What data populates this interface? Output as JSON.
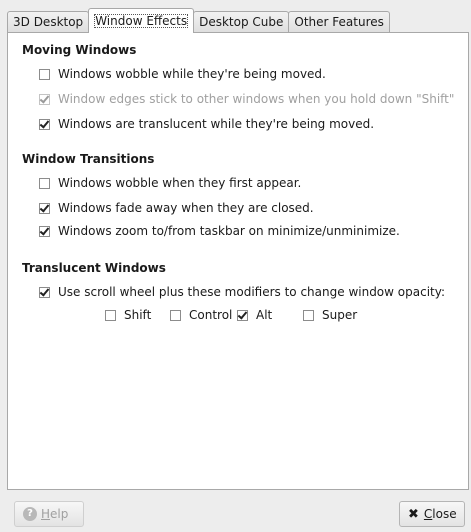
{
  "tabs": [
    "3D Desktop",
    "Window Effects",
    "Desktop Cube",
    "Other Features"
  ],
  "active_tab": "Window Effects",
  "sections": {
    "moving": {
      "title": "Moving Windows",
      "items": [
        {
          "label": "Windows wobble while they're being moved.",
          "checked": false,
          "enabled": true
        },
        {
          "label": "Window edges stick to other windows when you hold down \"Shift\"",
          "checked": true,
          "enabled": false
        },
        {
          "label": "Windows are translucent while they're being moved.",
          "checked": true,
          "enabled": true
        }
      ]
    },
    "transitions": {
      "title": "Window Transitions",
      "items": [
        {
          "label": "Windows wobble when they first appear.",
          "checked": false,
          "enabled": true
        },
        {
          "label": "Windows fade away when they are closed.",
          "checked": true,
          "enabled": true
        },
        {
          "label": "Windows zoom to/from taskbar on minimize/unminimize.",
          "checked": true,
          "enabled": true
        }
      ]
    },
    "translucent": {
      "title": "Translucent Windows",
      "items": [
        {
          "label": "Use scroll wheel plus these modifiers to change window opacity:",
          "checked": true,
          "enabled": true
        }
      ],
      "modifiers": [
        {
          "label": "Shift",
          "checked": false
        },
        {
          "label": "Control",
          "checked": false
        },
        {
          "label": "Alt",
          "checked": true
        },
        {
          "label": "Super",
          "checked": false
        }
      ]
    }
  },
  "buttons": {
    "help": {
      "label": "Help",
      "mnemonic": "H",
      "rest": "elp",
      "enabled": false
    },
    "close": {
      "label": "Close",
      "mnemonic": "C",
      "rest": "lose",
      "enabled": true
    }
  }
}
